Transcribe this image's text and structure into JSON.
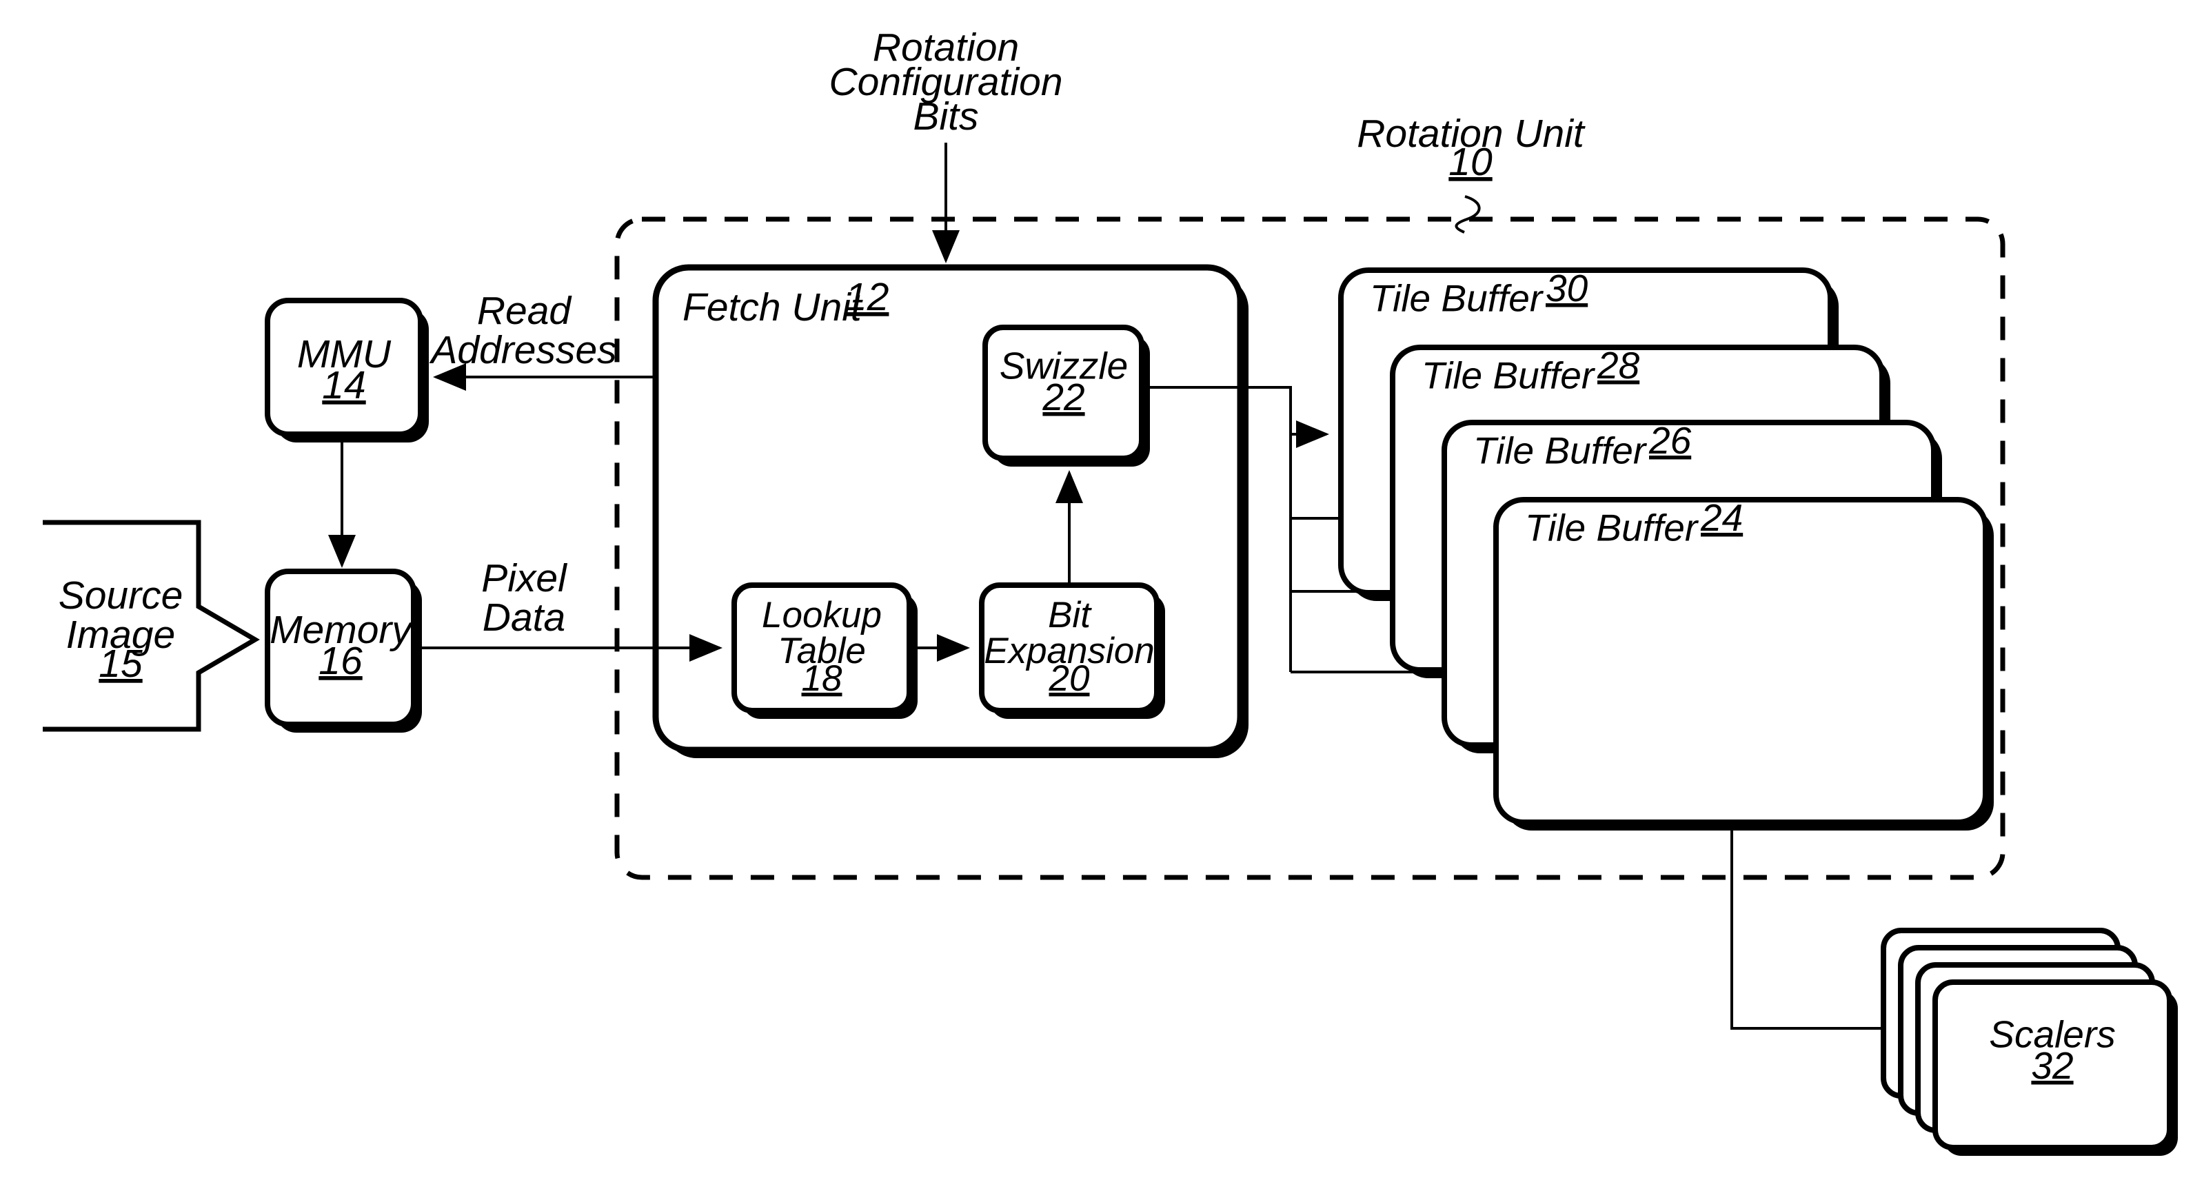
{
  "figure": {
    "title": "Rotation Unit block diagram",
    "ink_color": "#000000",
    "background_color": "#ffffff"
  },
  "annotations": {
    "rotation_config_bits": "Rotation\nConfiguration\nBits",
    "rotation_config_bits_line1": "Rotation",
    "rotation_config_bits_line2": "Configuration",
    "rotation_config_bits_line3": "Bits",
    "rotation_unit_line1": "Rotation Unit",
    "rotation_unit_ref": "10",
    "read_addresses_line1": "Read",
    "read_addresses_line2": "Addresses",
    "pixel_data_line1": "Pixel",
    "pixel_data_line2": "Data"
  },
  "blocks": {
    "source_image": {
      "label_line1": "Source",
      "label_line2": "Image",
      "ref": "15"
    },
    "mmu": {
      "label": "MMU",
      "ref": "14"
    },
    "memory": {
      "label": "Memory",
      "ref": "16"
    },
    "fetch_unit": {
      "label": "Fetch Unit",
      "ref": "12"
    },
    "lookup_table": {
      "label_line1": "Lookup",
      "label_line2": "Table",
      "ref": "18"
    },
    "bit_expansion": {
      "label_line1": "Bit",
      "label_line2": "Expansion",
      "ref": "20"
    },
    "swizzle": {
      "label": "Swizzle",
      "ref": "22"
    },
    "scalers": {
      "label": "Scalers",
      "ref": "32"
    }
  },
  "tile_buffers": [
    {
      "label": "Tile Buffer",
      "ref": "30"
    },
    {
      "label": "Tile Buffer",
      "ref": "28"
    },
    {
      "label": "Tile Buffer",
      "ref": "26"
    },
    {
      "label": "Tile Buffer",
      "ref": "24"
    }
  ]
}
